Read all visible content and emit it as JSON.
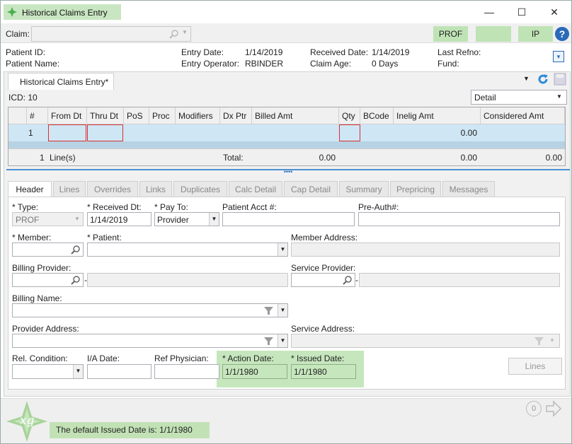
{
  "window": {
    "title": "Historical Claims Entry",
    "minimize": "—",
    "maximize": "☐",
    "close": "✕"
  },
  "claimbar": {
    "claim_label": "Claim:",
    "claim_value": "",
    "btn_prof": "PROF",
    "btn_blank": "",
    "btn_ip": "IP",
    "help": "?"
  },
  "info": {
    "patient_id_label": "Patient ID:",
    "patient_name_label": "Patient Name:",
    "entry_date_label": "Entry Date:",
    "entry_date": "1/14/2019",
    "entry_operator_label": "Entry Operator:",
    "entry_operator": "RBINDER",
    "received_date_label": "Received Date:",
    "received_date": "1/14/2019",
    "claim_age_label": "Claim Age:",
    "claim_age": "0 Days",
    "last_refno_label": "Last Refno:",
    "fund_label": "Fund:"
  },
  "doc_tab": {
    "label": "Historical Claims Entry*"
  },
  "icd": {
    "label": "ICD: 10",
    "view_select": "Detail"
  },
  "grid": {
    "columns": [
      "#",
      "From Dt",
      "Thru Dt",
      "PoS",
      "Proc",
      "Modifiers",
      "Dx Ptr",
      "Billed Amt",
      "Qty",
      "BCode",
      "Inelig Amt",
      "Considered Amt"
    ],
    "row": {
      "num": "1",
      "inelig": "0.00"
    },
    "footer": {
      "lines_count": "1",
      "lines_label": "Line(s)",
      "total_label": "Total:",
      "billed_total": "0.00",
      "inelig_total": "0.00",
      "considered_total": "0.00"
    }
  },
  "tabs": [
    "Header",
    "Lines",
    "Overrides",
    "Links",
    "Duplicates",
    "Calc Detail",
    "Cap Detail",
    "Summary",
    "Prepricing",
    "Messages"
  ],
  "form": {
    "type_label": "* Type:",
    "type_value": "PROF",
    "received_dt_label": "* Received Dt:",
    "received_dt_value": "1/14/2019",
    "pay_to_label": "* Pay To:",
    "pay_to_value": "Provider",
    "patient_acct_label": "Patient Acct #:",
    "pre_auth_label": "Pre-Auth#:",
    "member_label": "* Member:",
    "patient_label": "* Patient:",
    "member_address_label": "Member Address:",
    "billing_provider_label": "Billing Provider:",
    "service_provider_label": "Service Provider:",
    "billing_name_label": "Billing Name:",
    "provider_address_label": "Provider Address:",
    "service_address_label": "Service Address:",
    "rel_condition_label": "Rel. Condition:",
    "ia_date_label": "I/A Date:",
    "ref_physician_label": "Ref Physician:",
    "action_date_label": "* Action Date:",
    "action_date_value": "1/1/1980",
    "issued_date_label": "* Issued Date:",
    "issued_date_value": "1/1/1980",
    "lines_button": "Lines",
    "dash": "-"
  },
  "status": {
    "message": "The default Issued Date is: 1/1/1980",
    "logo": "xg",
    "count": "0"
  },
  "colors": {
    "accent_green": "#c6e6bd",
    "selected_row": "#cfe6f5",
    "error_border": "#d83030",
    "help_blue": "#2a6ab8"
  }
}
